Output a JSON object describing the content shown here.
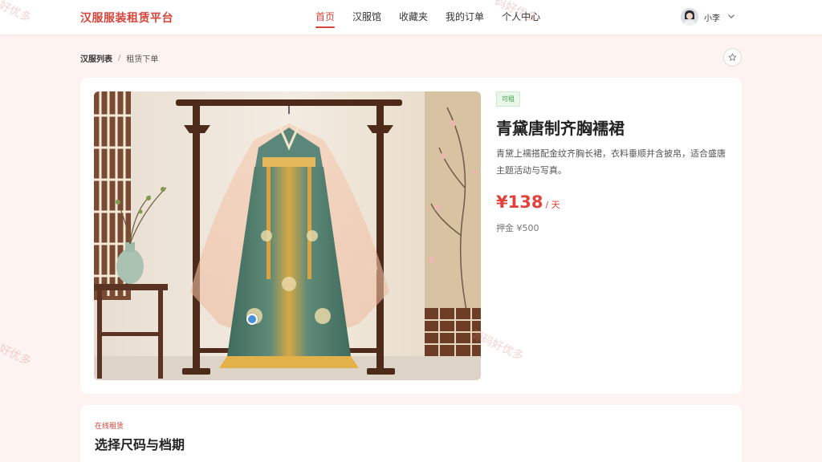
{
  "header": {
    "brand": "汉服服装租赁平台",
    "nav": [
      {
        "label": "首页",
        "active": true
      },
      {
        "label": "汉服馆",
        "active": false
      },
      {
        "label": "收藏夹",
        "active": false
      },
      {
        "label": "我的订单",
        "active": false
      },
      {
        "label": "个人中心",
        "active": false
      }
    ],
    "user": {
      "name": "小李",
      "avatar_icon": "user-avatar",
      "dropdown_icon": "chevron-down-icon"
    }
  },
  "breadcrumb": {
    "items": [
      "汉服列表",
      "租赁下单"
    ],
    "separator": "/"
  },
  "favorite": {
    "icon": "star-outline-icon"
  },
  "product": {
    "status_badge": "可租",
    "name": "青黛唐制齐胸襦裙",
    "description": "青黛上襦搭配金纹齐胸长裙，衣料垂顺并含披帛，适合盛唐主题活动与写真。",
    "price": "¥138",
    "price_unit": "/ 天",
    "deposit": "押金 ¥500"
  },
  "rental_section": {
    "label": "在线租赁",
    "title": "选择尺码与档期"
  },
  "watermarks": [
    "好优多",
    "码好优多",
    "好优多",
    "源码好优多"
  ],
  "colors": {
    "accent": "#d4453b",
    "price": "#e5413c",
    "badge_bg": "#eaf7ea",
    "badge_text": "#3da94b",
    "page_bg": "#fdf3f0"
  }
}
